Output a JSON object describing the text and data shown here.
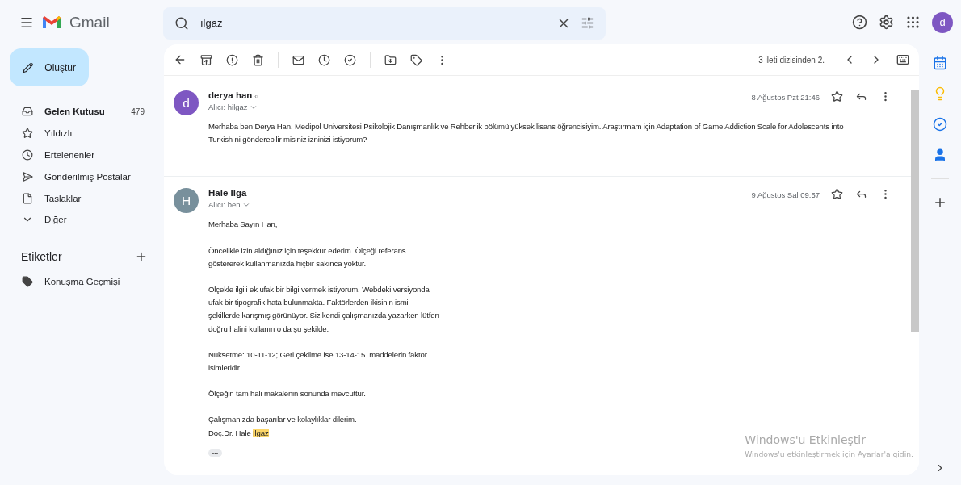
{
  "app": {
    "name": "Gmail"
  },
  "search": {
    "value": "ılgaz"
  },
  "account": {
    "initial": "d"
  },
  "compose": {
    "label": "Oluştur"
  },
  "sidebar": {
    "items": [
      {
        "label": "Gelen Kutusu",
        "count": "479",
        "selected": true
      },
      {
        "label": "Yıldızlı",
        "selected": false
      },
      {
        "label": "Ertelenenler",
        "selected": false
      },
      {
        "label": "Gönderilmiş Postalar",
        "selected": false
      },
      {
        "label": "Taslaklar",
        "selected": false
      },
      {
        "label": "Diğer",
        "selected": false
      }
    ],
    "labels_title": "Etiketler",
    "labels": [
      {
        "label": "Konuşma Geçmişi"
      }
    ]
  },
  "toolbar": {
    "position": "3 ileti dizisinden 2."
  },
  "messages": [
    {
      "initial": "d",
      "color": "#7e57c2",
      "sender": "derya han",
      "sender_hint": "‹ı",
      "to": "Alıcı: hilgaz",
      "date": "8 Ağustos Pzt 21:46",
      "paragraphs": [
        {
          "lines": [
            "Merhaba ben Derya Han. Medipol Üniversitesi Psikolojik Danışmanlık ve Rehberlik bölümü yüksek lisans öğrencisiyim. Araştırmam için  Adaptation of Game Addiction Scale for Adolescents into",
            "Turkish ni gönderebilir misiniz izninizi istiyorum?"
          ]
        }
      ]
    },
    {
      "initial": "H",
      "color": "#78909c",
      "sender": "Hale Ilga",
      "to": "Alıcı: ben",
      "date": "9 Ağustos Sal 09:57",
      "paragraphs": [
        {
          "lines": [
            "Merhaba Sayın Han,"
          ]
        },
        {
          "lines": [
            "Öncelikle izin aldığınız için teşekkür ederim. Ölçeği referans",
            "göstererek kullanmanızda hiçbir sakınca yoktur."
          ]
        },
        {
          "lines": [
            "Ölçekle ilgili ek ufak bir bilgi vermek istiyorum. Webdeki versiyonda",
            "ufak bir tipografik hata bulunmakta. Faktörlerden ikisinin ismi",
            "şekillerde karışmış görünüyor. Siz kendi çalışmanızda yazarken lütfen",
            "doğru halini kullanın o da şu şekilde:"
          ]
        },
        {
          "lines": [
            "Nüksetme: 10-11-12; Geri çekilme ise 13-14-15. maddelerin faktör",
            "isimleridir."
          ]
        },
        {
          "lines": [
            "Ölçeğin tam hali makalenin sonunda mevcuttur."
          ]
        },
        {
          "lines": [
            "Çalışmanızda başarılar ve kolaylıklar dilerim."
          ],
          "signature": {
            "text": "Doç.Dr. Hale ",
            "highlight": "Ilgaz"
          }
        }
      ],
      "trimmed": "•••"
    }
  ],
  "activation": {
    "title": "Windows'u Etkinleştir",
    "subtitle": "Windows'u etkinleştirmek için Ayarlar'a gidin."
  }
}
